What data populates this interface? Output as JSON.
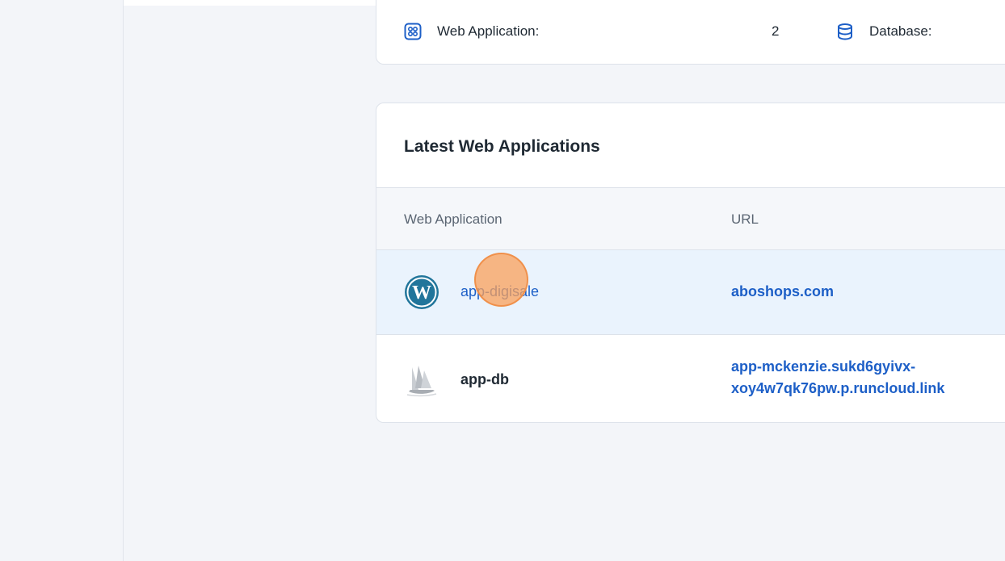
{
  "stats": {
    "web_app_label": "Web Application:",
    "web_app_count": "2",
    "database_label": "Database:"
  },
  "latest": {
    "title": "Latest Web Applications",
    "columns": [
      "Web Application",
      "URL"
    ],
    "rows": [
      {
        "name": "app-digisale",
        "url": "aboshops.com",
        "icon": "wordpress-icon"
      },
      {
        "name": "app-db",
        "url_line1": "app-mckenzie.sukd6gyivx-",
        "url_line2": "xoy4w7qk76pw.p.runcloud.link",
        "icon": "sailboat-icon"
      }
    ]
  },
  "colors": {
    "accent": "#1d5fc7",
    "active_row": "#eaf3fd",
    "cursor": "#f7a35c"
  }
}
